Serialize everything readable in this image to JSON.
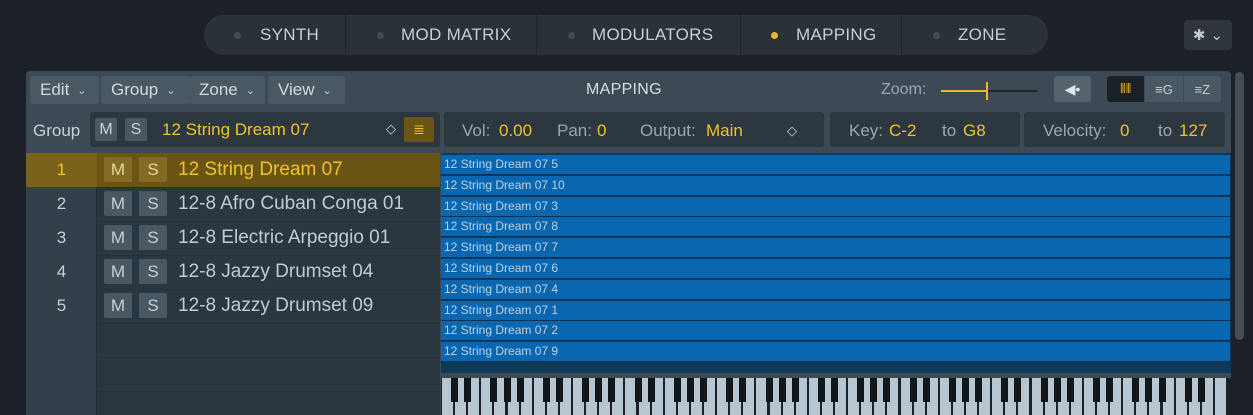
{
  "tabs": [
    {
      "label": "SYNTH",
      "active": false
    },
    {
      "label": "MOD MATRIX",
      "active": false
    },
    {
      "label": "MODULATORS",
      "active": false
    },
    {
      "label": "MAPPING",
      "active": true
    },
    {
      "label": "ZONE",
      "active": false
    }
  ],
  "settings": {
    "icon": "gear-icon",
    "chevron": "⌄"
  },
  "toolbar": {
    "menus": [
      {
        "label": "Edit"
      },
      {
        "label": "Group"
      },
      {
        "label": "Zone"
      },
      {
        "label": "View"
      }
    ],
    "title": "MAPPING",
    "zoom_label": "Zoom:",
    "zoom_level": 0.48,
    "speaker_icon": "speaker-icon",
    "view_modes": [
      {
        "icon": "keyboard-icon",
        "text": "",
        "active": true
      },
      {
        "icon": "list-group-icon",
        "text": "G",
        "active": false
      },
      {
        "icon": "list-zone-icon",
        "text": "Z",
        "active": false
      }
    ]
  },
  "group_bar": {
    "label": "Group",
    "mute": "M",
    "solo": "S",
    "name": "12 String Dream 07",
    "stepper": "◇"
  },
  "params": {
    "vol_label": "Vol:",
    "vol": "0.00",
    "pan_label": "Pan:",
    "pan": "0",
    "output_label": "Output:",
    "output": "Main",
    "output_stepper": "◇",
    "key_label": "Key:",
    "key_low": "C-2",
    "key_to": "to",
    "key_high": "G8",
    "vel_label": "Velocity:",
    "vel_low": "0",
    "vel_to": "to",
    "vel_high": "127"
  },
  "groups": [
    {
      "index": "1",
      "mute": "M",
      "solo": "S",
      "name": "12 String Dream 07",
      "selected": true
    },
    {
      "index": "2",
      "mute": "M",
      "solo": "S",
      "name": "12-8 Afro Cuban Conga 01",
      "selected": false
    },
    {
      "index": "3",
      "mute": "M",
      "solo": "S",
      "name": "12-8 Electric Arpeggio 01",
      "selected": false
    },
    {
      "index": "4",
      "mute": "M",
      "solo": "S",
      "name": "12-8 Jazzy Drumset 04",
      "selected": false
    },
    {
      "index": "5",
      "mute": "M",
      "solo": "S",
      "name": "12-8 Jazzy Drumset 09",
      "selected": false
    }
  ],
  "zones": [
    {
      "label": "12 String Dream 07 5"
    },
    {
      "label": "12 String Dream 07 10"
    },
    {
      "label": "12 String Dream 07 3"
    },
    {
      "label": "12 String Dream 07 8"
    },
    {
      "label": "12 String Dream 07 7"
    },
    {
      "label": "12 String Dream 07 6"
    },
    {
      "label": "12 String Dream 07 4"
    },
    {
      "label": "12 String Dream 07 1"
    },
    {
      "label": "12 String Dream 07 2"
    },
    {
      "label": "12 String Dream 07 9"
    }
  ],
  "colors": {
    "accent": "#e9b92c",
    "zone": "#0b66b0",
    "panel": "#3d4a55"
  }
}
